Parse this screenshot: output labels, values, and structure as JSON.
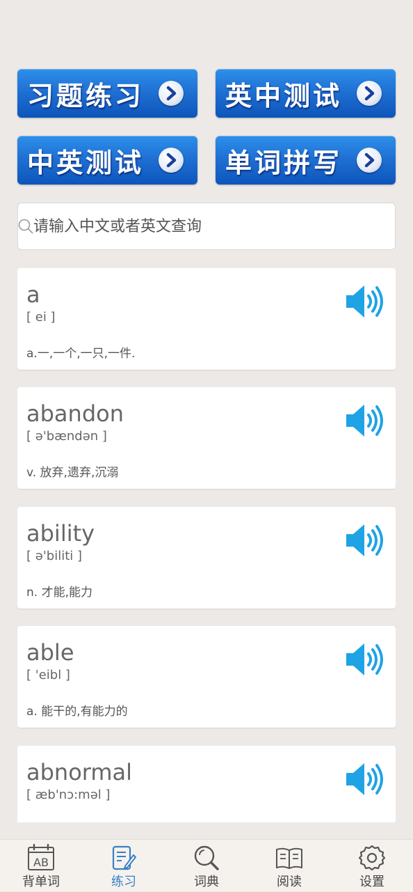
{
  "quiz_buttons": [
    {
      "label": "习题练习"
    },
    {
      "label": "英中测试"
    },
    {
      "label": "中英测试"
    },
    {
      "label": "单词拼写"
    }
  ],
  "search": {
    "placeholder": "请输入中文或者英文查询",
    "value": ""
  },
  "words": [
    {
      "word": "a",
      "phonetic": "[ ei ]",
      "definition": "a.一,一个,一只,一件."
    },
    {
      "word": "abandon",
      "phonetic": "[ ə'bændən ]",
      "definition": "v. 放弃,遗弃,沉溺"
    },
    {
      "word": "ability",
      "phonetic": "[ ə'biliti ]",
      "definition": "n. 才能,能力"
    },
    {
      "word": "able",
      "phonetic": "[ 'eibl ]",
      "definition": "a. 能干的,有能力的"
    },
    {
      "word": "abnormal",
      "phonetic": "[ æb'nɔ:məl ]",
      "definition": ""
    }
  ],
  "tabbar": {
    "active": "练习",
    "tabs": [
      {
        "label": "背单词",
        "icon": "calendar-ab-icon"
      },
      {
        "label": "练习",
        "icon": "edit-note-icon"
      },
      {
        "label": "词典",
        "icon": "search-icon"
      },
      {
        "label": "阅读",
        "icon": "book-icon"
      },
      {
        "label": "设置",
        "icon": "gear-icon"
      }
    ]
  },
  "colors": {
    "background": "#ece9e6",
    "button_blue": "#1f6fd3",
    "speaker_blue": "#1fa3e5",
    "active_tab": "#3a7fc4"
  }
}
